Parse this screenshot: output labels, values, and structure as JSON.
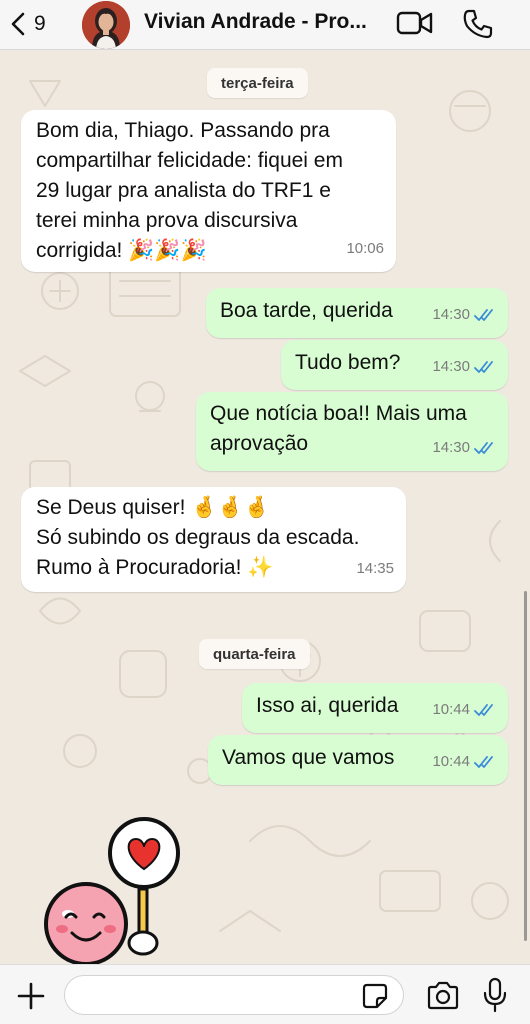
{
  "header": {
    "back_count": "9",
    "contact_name": "Vivian Andrade - Pro...",
    "icons": {
      "back": "chevron-left-icon",
      "video": "video-call-icon",
      "phone": "phone-call-icon"
    }
  },
  "colors": {
    "wallpaper": "#efe9e0",
    "incoming_bubble": "#ffffff",
    "outgoing_bubble": "#d8fdd2",
    "read_ticks": "#3a8bd8",
    "icon": "#111111"
  },
  "chat": {
    "days": [
      {
        "label": "terça-feira"
      },
      {
        "label": "quarta-feira"
      }
    ],
    "messages": [
      {
        "direction": "in",
        "text": "Bom dia, Thiago. Passando pra\ncompartilhar felicidade: fiquei em\n29 lugar pra analista do TRF1 e\nterei minha prova discursiva\ncorrigida! 🎉🎉🎉",
        "time": "10:06"
      },
      {
        "direction": "out",
        "text": "Boa tarde, querida",
        "time": "14:30"
      },
      {
        "direction": "out",
        "text": "Tudo bem?",
        "time": "14:30"
      },
      {
        "direction": "out",
        "text": "Que notícia boa!! Mais uma\naprovação",
        "time": "14:30"
      },
      {
        "direction": "in",
        "text": "Se Deus quiser! 🤞🤞🤞\nSó subindo os degraus da escada.\nRumo à Procuradoria! ✨",
        "time": "14:35"
      },
      {
        "direction": "out",
        "text": "Isso ai, querida",
        "time": "10:44"
      },
      {
        "direction": "out",
        "text": "Vamos que vamos",
        "time": "10:44"
      }
    ],
    "sticker": "smiley-heart-sign-sticker"
  },
  "input_bar": {
    "placeholder": "",
    "icons": {
      "plus": "plus-icon",
      "sticker": "sticker-icon",
      "camera": "camera-icon",
      "mic": "microphone-icon"
    }
  }
}
